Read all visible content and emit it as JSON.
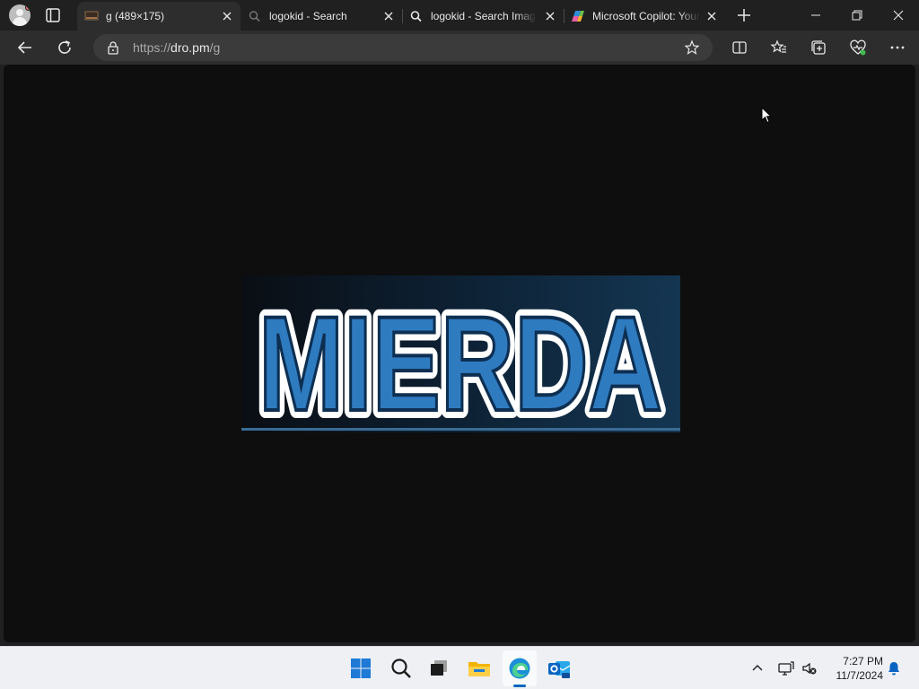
{
  "tabs": [
    {
      "title": "g (489×175)",
      "active": true,
      "favicon": "image-favicon-icon"
    },
    {
      "title": "logokid - Search",
      "active": false,
      "favicon": "search-favicon-icon"
    },
    {
      "title": "logokid - Search Images",
      "active": false,
      "favicon": "search-favicon-icon"
    },
    {
      "title": "Microsoft Copilot: Your",
      "active": false,
      "favicon": "copilot-favicon-icon"
    }
  ],
  "address_bar": {
    "scheme": "https://",
    "host": "dro.pm",
    "path": "/g"
  },
  "image": {
    "text": "MIERDA",
    "natural_width": 489,
    "natural_height": 175
  },
  "taskbar": {
    "apps": [
      "windows-start-icon",
      "search-icon",
      "task-view-icon",
      "file-explorer-icon",
      "edge-icon",
      "outlook-icon"
    ],
    "clock": {
      "time": "7:27 PM",
      "date": "11/7/2024"
    }
  },
  "colors": {
    "logo_blue": "#2f7bc0",
    "accent": "#0067c0"
  }
}
